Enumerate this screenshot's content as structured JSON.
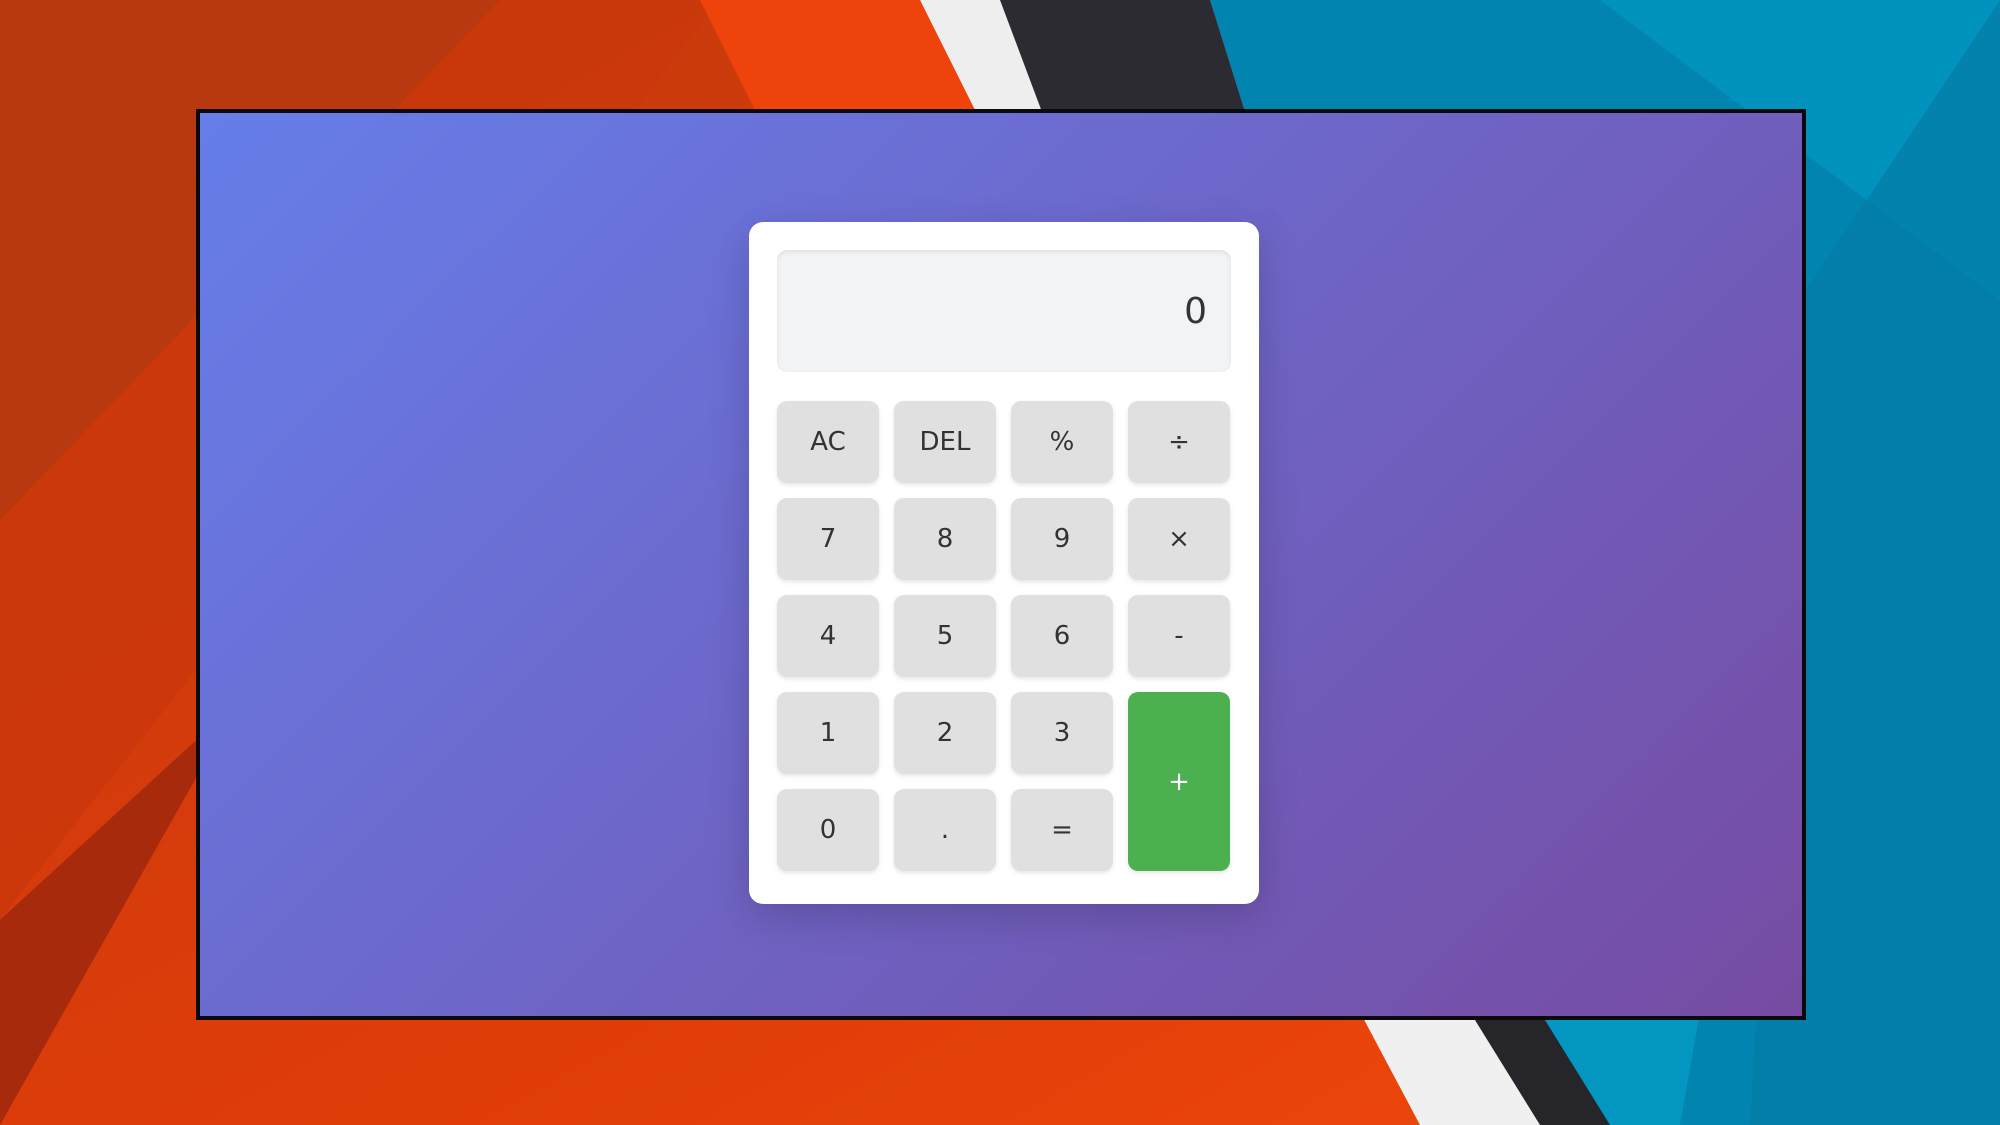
{
  "colors": {
    "window_gradient_start": "#667eea",
    "window_gradient_end": "#764ba2",
    "key_background": "#e0e0e0",
    "accent_plus": "#4caf50",
    "display_background": "#f2f3f4"
  },
  "calculator": {
    "display_value": "0",
    "keys": {
      "ac": "AC",
      "del": "DEL",
      "percent": "%",
      "divide": "÷",
      "seven": "7",
      "eight": "8",
      "nine": "9",
      "multiply": "×",
      "four": "4",
      "five": "5",
      "six": "6",
      "minus": "-",
      "one": "1",
      "two": "2",
      "three": "3",
      "plus": "+",
      "zero": "0",
      "decimal": ".",
      "equals": "="
    }
  }
}
